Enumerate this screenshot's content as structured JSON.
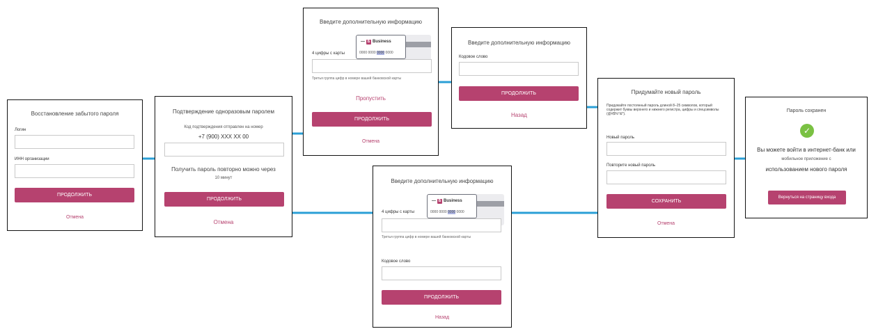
{
  "colors": {
    "connector": "#2a9fd6",
    "brand": "#b6426f",
    "success": "#7ac143",
    "card_highlight": "#aab2e0"
  },
  "screens": {
    "recover": {
      "title": "Восстановление забытого пароля",
      "login_label": "Логин",
      "inn_label": "ИНН организации",
      "continue": "ПРОДОЛЖИТЬ",
      "cancel": "Отмена"
    },
    "otp": {
      "title": "Подтверждение одноразовым паролем",
      "sent_text": "Код подтверждения отправлен на номер",
      "phone": "+7 (900) XXX XX 00",
      "resend_text": "Получить пароль повторно можно через",
      "resend_time": "10 минут",
      "continue": "ПРОДОЛЖИТЬ",
      "cancel": "Отмена"
    },
    "card_digits": {
      "title": "Введите дополнительную информацию",
      "field_label": "4 цифры с карты",
      "card_brand": "Business",
      "card_number": [
        "0000",
        "0000",
        "0000",
        "0000"
      ],
      "hint": "Третья группа цифр в номере вашей банковской карты",
      "skip": "Пропустить",
      "continue": "ПРОДОЛЖИТЬ",
      "cancel": "Отмена"
    },
    "codeword": {
      "title": "Введите дополнительную информацию",
      "field_label": "Кодовое слово",
      "continue": "ПРОДОЛЖИТЬ",
      "back": "Назад"
    },
    "combined": {
      "title": "Введите дополнительную информацию",
      "field_label": "4 цифры с карты",
      "card_brand": "Business",
      "card_number": [
        "0000",
        "0000",
        "0000",
        "0000"
      ],
      "hint": "Третья группа цифр в номере вашей банковской карты",
      "codeword_label": "Кодовое слово",
      "continue": "ПРОДОЛЖИТЬ",
      "back": "Назад"
    },
    "new_password": {
      "title": "Придумайте новый пароль",
      "rules": "Придумайте постоянный пароль длиной 8–25 символов, который содержит буквы верхнего и нижнего регистра, цифры и спецсимволы (@#$%^&*).",
      "new_label": "Новый пароль",
      "repeat_label": "Повторите новый пароль",
      "save": "СОХРАНИТЬ",
      "cancel": "Отмена"
    },
    "saved": {
      "title": "Пароль сохранен",
      "check_icon": "check-circle-icon",
      "message_line1": "Вы можете войти в интернет-банк или",
      "message_line2": "мобильное приложение с",
      "message_line3": "использованием нового пароля",
      "back_button": "Вернуться на страницу входа"
    }
  }
}
